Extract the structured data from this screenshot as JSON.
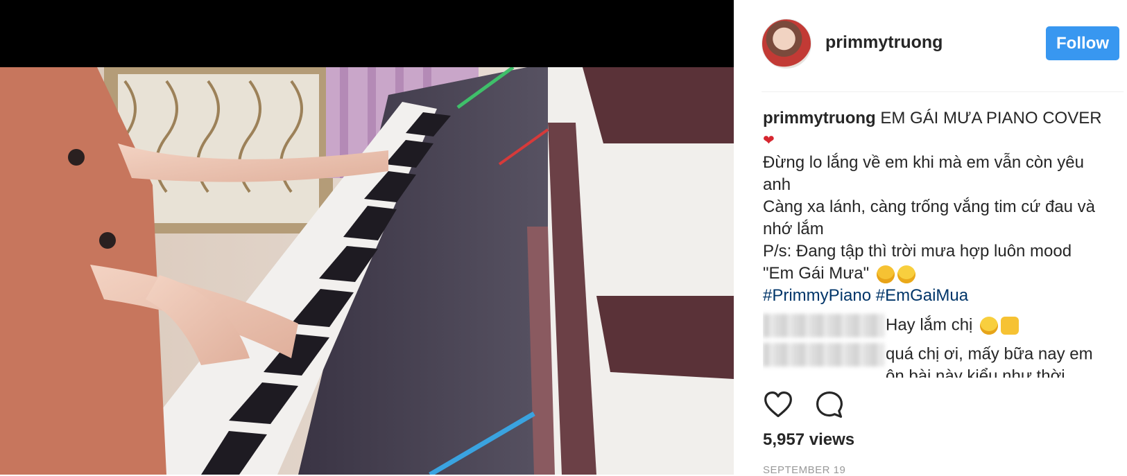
{
  "post": {
    "username": "primmytruong",
    "follow_label": "Follow",
    "caption_user": "primmytruong",
    "caption_title": " EM GÁI MƯA PIANO COVER",
    "caption_heart": "❤",
    "caption_lines": [
      "Đừng lo lắng về em khi mà em vẫn còn yêu anh",
      "Càng xa lánh, càng trống vắng tim cứ đau và nhớ lắm",
      "P/s: Đang tập thì trời mưa hợp luôn mood \"Em Gái Mưa\""
    ],
    "emojis_line3": [
      "rolling-on-floor-laughing-emoji",
      "squinting-laughing-emoji"
    ],
    "hashtags": [
      "#PrimmyPiano",
      "#EmGaiMua"
    ],
    "views": "5,957 views",
    "date": "SEPTEMBER 19"
  },
  "comments": [
    {
      "text": "Hay lắm chị",
      "emojis": [
        "smiling-emoji",
        "thumbs-up-emoji"
      ]
    },
    {
      "text": "quá chị ơi, mấy bữa nay em",
      "text2": "ôn bài này kiểu như thời"
    }
  ],
  "colors": {
    "accent": "#3897f0",
    "hashtag": "#003569",
    "text": "#262626",
    "muted": "#999999"
  },
  "icons": {
    "like": "heart-icon",
    "comment": "comment-bubble-icon"
  }
}
